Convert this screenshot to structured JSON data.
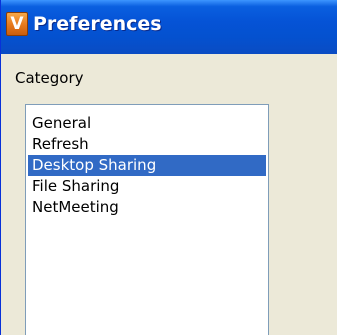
{
  "window": {
    "title": "Preferences",
    "icon_letter": "V",
    "icon_name": "app-icon",
    "title_bar_color": "#0553d6",
    "icon_color": "#e6781b"
  },
  "category": {
    "label": "Category",
    "items": [
      {
        "label": "General",
        "selected": false
      },
      {
        "label": "Refresh",
        "selected": false
      },
      {
        "label": "Desktop Sharing",
        "selected": true
      },
      {
        "label": "File Sharing",
        "selected": false
      },
      {
        "label": "NetMeeting",
        "selected": false
      }
    ],
    "selection_color": "#316ac5"
  }
}
